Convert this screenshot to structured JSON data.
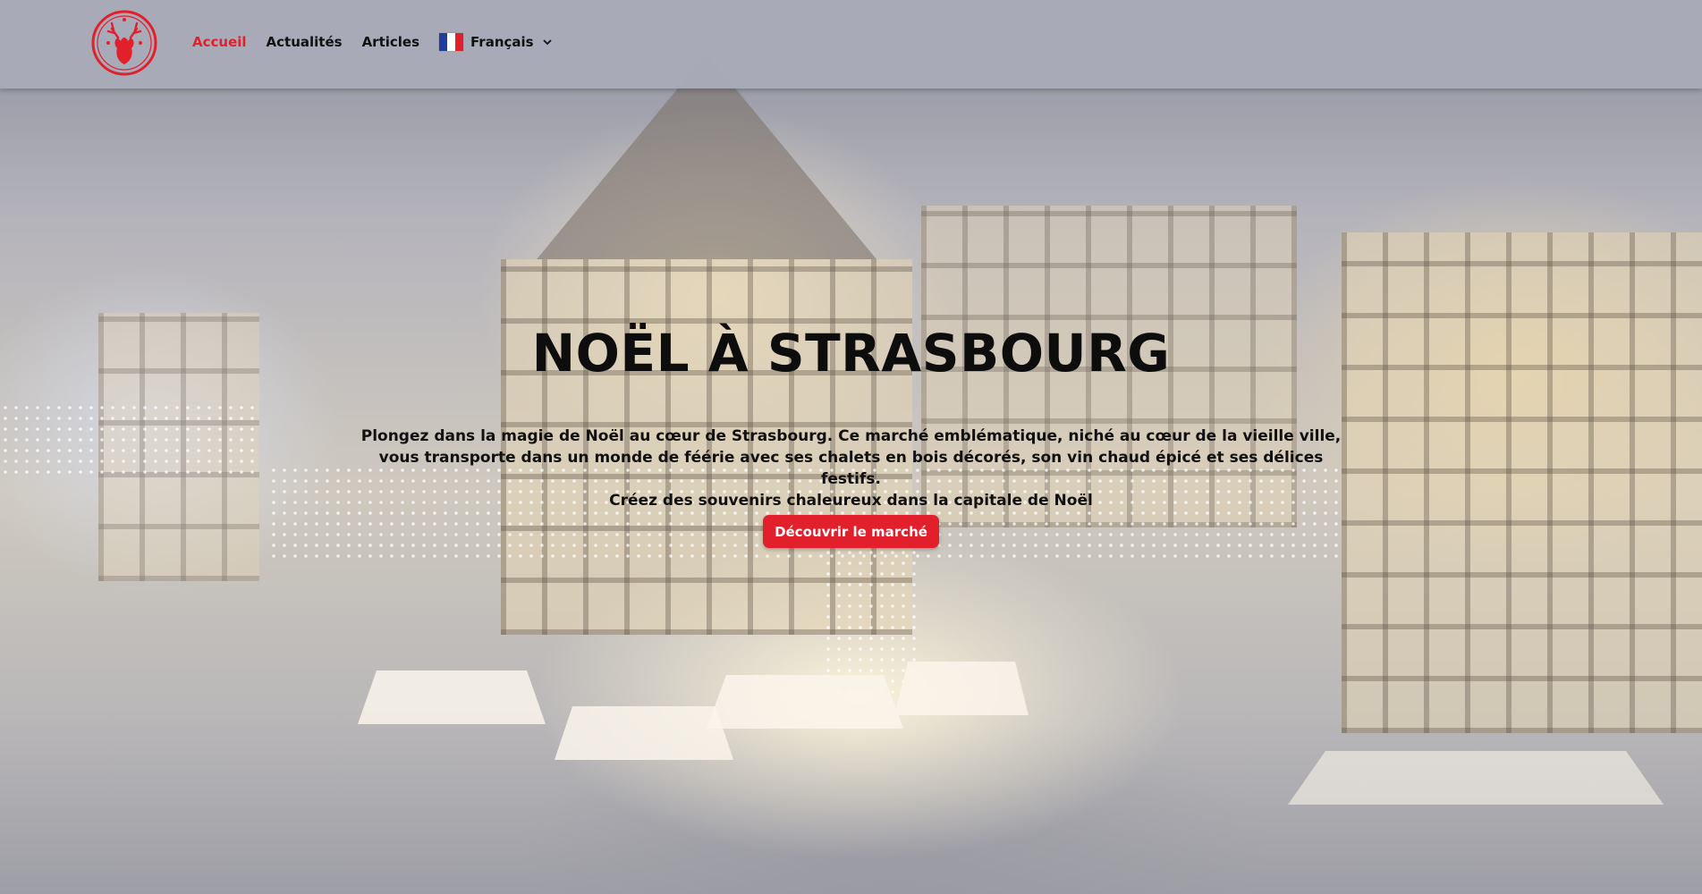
{
  "nav": {
    "items": [
      {
        "label": "Accueil",
        "active": true
      },
      {
        "label": "Actualités",
        "active": false
      },
      {
        "label": "Articles",
        "active": false
      }
    ],
    "language": {
      "label": "Français",
      "flag": "french-flag-icon"
    }
  },
  "hero": {
    "title": "NOËL À STRASBOURG",
    "line1": "Plongez dans la magie de Noël au cœur de Strasbourg. Ce marché emblématique, niché au cœur de la vieille ville,",
    "line2": "vous transporte dans un monde de féérie avec ses chalets en bois décorés, son vin chaud épicé et ses délices festifs.",
    "line3": "Créez des souvenirs chaleureux dans la capitale de Noël",
    "cta_label": "Découvrir le marché"
  },
  "colors": {
    "accent": "#e1202c",
    "header_bg": "#a9abb8",
    "text": "#111111"
  },
  "icons": {
    "logo": "reindeer-logo-icon",
    "chevron": "chevron-down-icon"
  }
}
